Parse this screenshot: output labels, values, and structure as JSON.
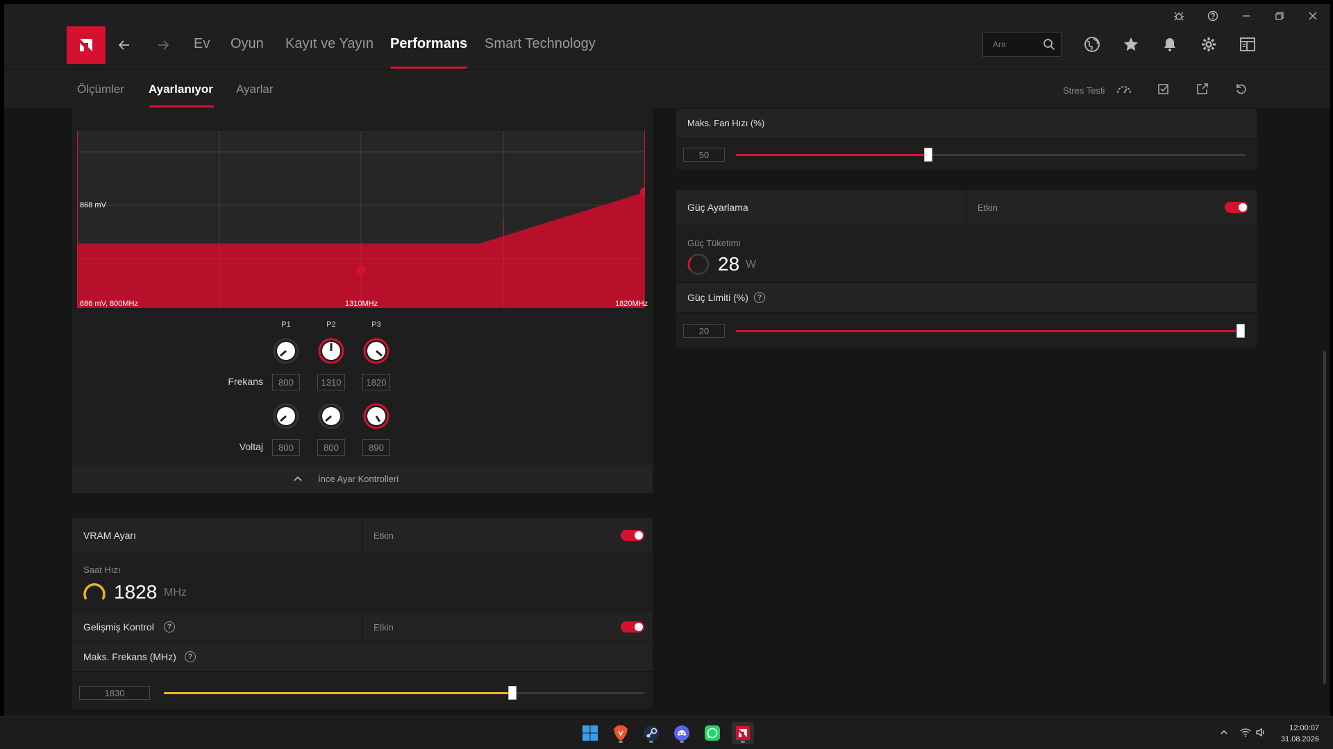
{
  "nav": {
    "items": [
      "Ev",
      "Oyun",
      "Kayıt ve Yayın",
      "Performans",
      "Smart Technology"
    ],
    "active": "Performans"
  },
  "search": {
    "placeholder": "Ara"
  },
  "subnav": {
    "items": [
      "Ölçümler",
      "Ayarlanıyor",
      "Ayarlar"
    ],
    "active": "Ayarlanıyor",
    "stress_test": "Stres Testi"
  },
  "curve": {
    "voltage_label": "868 mV",
    "start_label": "686 mV, 800MHz",
    "mid_label": "1310MHz",
    "end_label": "1820MHz"
  },
  "knobs": {
    "columns": [
      "P1",
      "P2",
      "P3"
    ],
    "frequency_label": "Frekans",
    "frequency_values": [
      "800",
      "1310",
      "1820"
    ],
    "voltage_label": "Voltaj",
    "voltage_values": [
      "800",
      "800",
      "890"
    ]
  },
  "fine_tune": {
    "label": "İnce Ayar Kontrolleri"
  },
  "vram": {
    "title": "VRAM Ayarı",
    "status": "Etkin",
    "clock_label": "Saat Hızı",
    "clock_value": "1828",
    "clock_unit": "MHz",
    "advanced_title": "Gelişmiş Kontrol",
    "advanced_status": "Etkin",
    "max_freq_title": "Maks. Frekans (MHz)",
    "max_freq_value": "1830",
    "max_freq_fraction": 0.725
  },
  "fan": {
    "title": "Maks. Fan Hızı (%)",
    "value": "50",
    "fraction": 0.378
  },
  "power": {
    "title": "Güç Ayarlama",
    "status": "Etkin",
    "consumption_label": "Güç Tüketimi",
    "consumption_value": "28",
    "consumption_unit": "W",
    "limit_title": "Güç Limiti (%)",
    "limit_value": "20",
    "limit_fraction": 0.99
  },
  "colors": {
    "accent": "#d4112f",
    "vram_accent": "#e8b51c",
    "background": "#181818"
  },
  "taskbar": {
    "apps": [
      "windows-start-icon",
      "brave-icon",
      "steam-icon",
      "discord-icon",
      "whatsapp-icon",
      "amd-adrenalin-icon"
    ],
    "time": "12:00:07",
    "date": "31.08.2026"
  }
}
